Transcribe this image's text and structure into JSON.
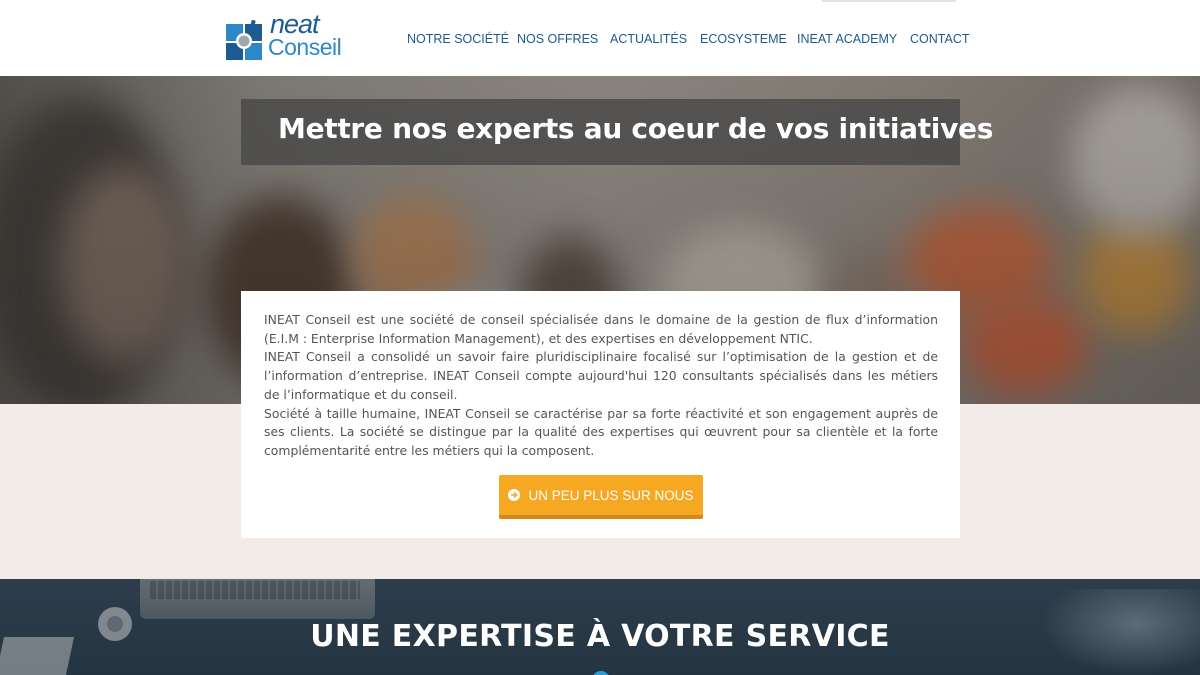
{
  "brand": {
    "logo_word1": "neat",
    "logo_word2": "Conseil",
    "colors": {
      "primary": "#1c5a8e",
      "accent": "#f7a823",
      "logo_light": "#2d88c9"
    }
  },
  "nav": {
    "items": [
      {
        "label": "NOTRE SOCIÉTÉ"
      },
      {
        "label": "NOS OFFRES"
      },
      {
        "label": "ACTUALITÉS"
      },
      {
        "label": "ECOSYSTEME"
      },
      {
        "label": "INEAT ACADEMY"
      },
      {
        "label": "CONTACT"
      }
    ]
  },
  "hero": {
    "title": "Mettre nos experts au coeur de vos  initiatives"
  },
  "intro": {
    "paragraphs": [
      "INEAT Conseil est une société de conseil spécialisée dans le domaine de la gestion de flux d’information (E.I.M : Enterprise Information Management), et des expertises en développement NTIC.",
      "INEAT Conseil a consolidé un savoir faire pluridisciplinaire focalisé sur l’optimisation de la gestion et de l’information d’entreprise. INEAT Conseil compte aujourd'hui 120 consultants spécialisés dans les métiers de l’informatique et du conseil.",
      "Société à taille humaine, INEAT Conseil se caractérise par sa forte réactivité et son engagement auprès de ses clients. La société se distingue par la qualité des expertises qui œuvrent pour sa clientèle et la forte complémentarité entre les métiers qui la composent."
    ],
    "cta_label": "UN PEU PLUS SUR NOUS",
    "cta_icon": "arrow-circle-right-icon"
  },
  "expertise": {
    "title": "UNE EXPERTISE À VOTRE SERVICE"
  }
}
